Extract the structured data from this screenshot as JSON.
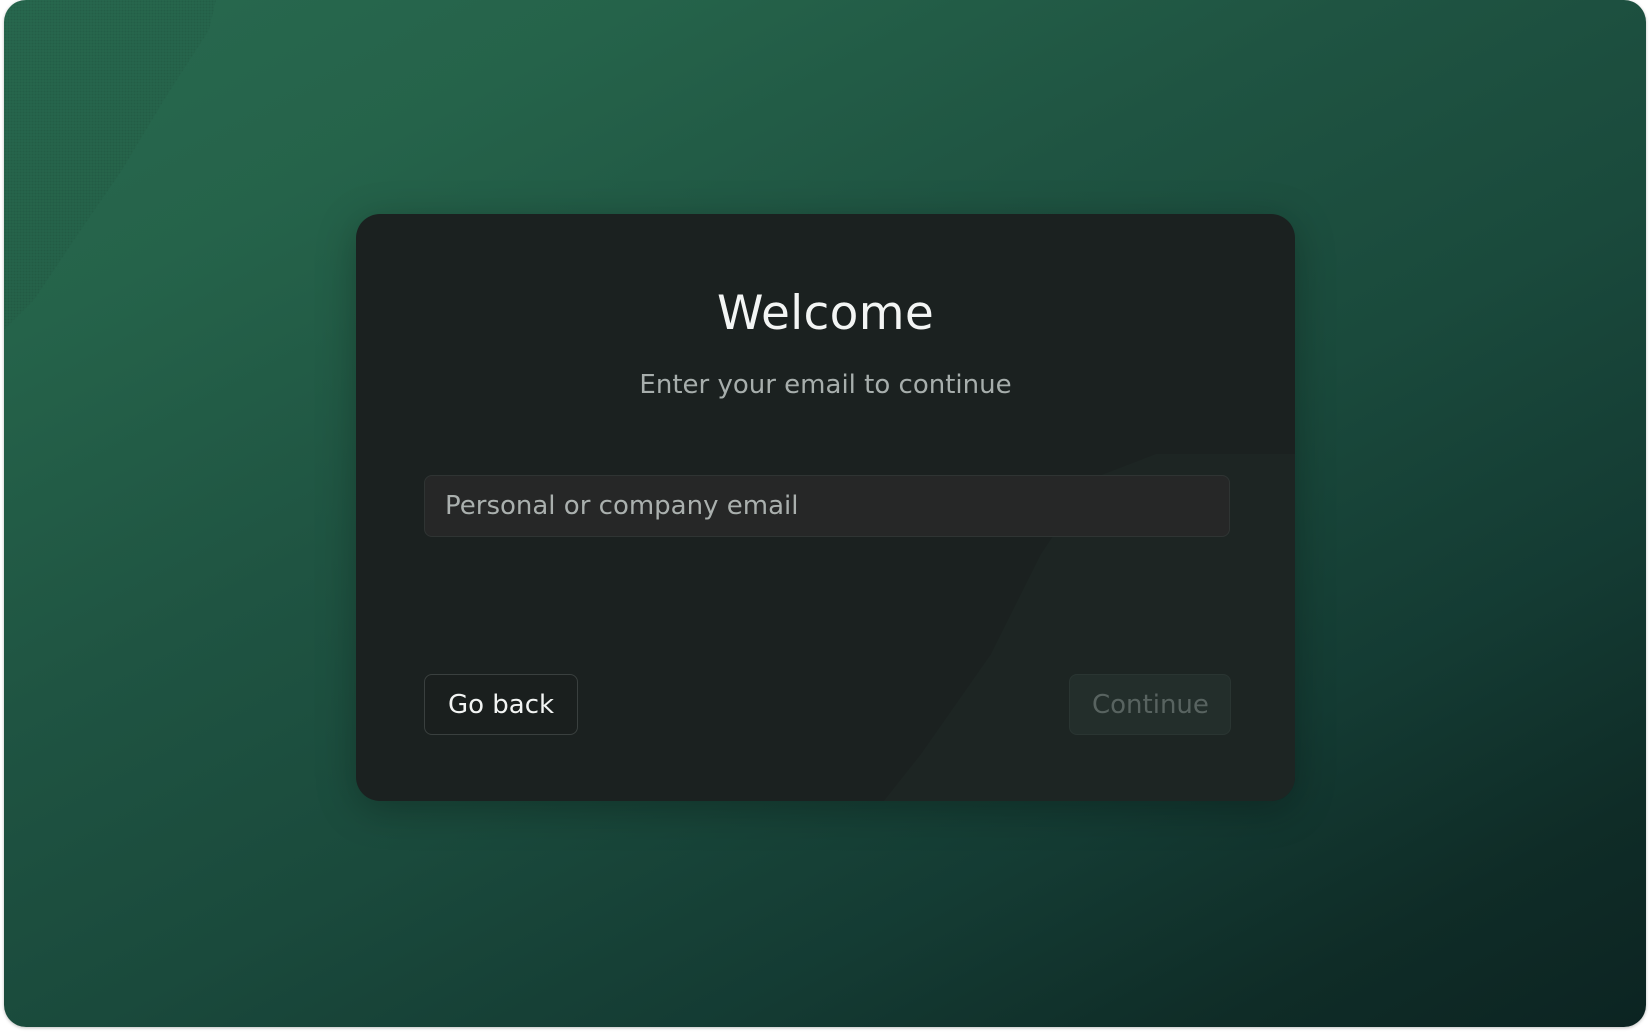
{
  "login": {
    "title": "Welcome",
    "subtitle": "Enter your email to continue",
    "email": {
      "value": "",
      "placeholder": "Personal or company email"
    },
    "back_label": "Go back",
    "continue_label": "Continue",
    "continue_disabled": true
  },
  "colors": {
    "background_start": "#28694f",
    "background_end": "#0c2422",
    "card": "#1b2120",
    "input": "#262727",
    "title_text": "#f3f5f4",
    "muted_text": "#a7aeac",
    "disabled_text": "#586360"
  }
}
